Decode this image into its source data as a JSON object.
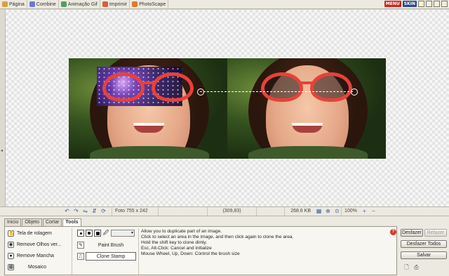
{
  "top_tabs": [
    {
      "label": "Página",
      "color": "#d8a040"
    },
    {
      "label": "Combine",
      "color": "#6a7ad0"
    },
    {
      "label": "Animação Gif",
      "color": "#50a060"
    },
    {
      "label": "Imprimir",
      "color": "#d06040"
    },
    {
      "label": "PhotoScape",
      "color": "#e07830"
    }
  ],
  "top_right": {
    "menu_label": "MENU",
    "skin_label": "SKIN"
  },
  "status": {
    "photo_info": "Foto 755 x 242",
    "coords": "(309,83)",
    "filesize": "268.6 KB",
    "zoom": "100%"
  },
  "tabs": [
    "Inicio",
    "Objeto",
    "Cortar",
    "Tools"
  ],
  "active_tab": "Tools",
  "tools": [
    {
      "label": "Tela de rolagem",
      "icon": "hand-icon"
    },
    {
      "label": "Remove Olhos ver...",
      "icon": "eye-icon"
    },
    {
      "label": "Remove Mancha",
      "icon": "spot-icon"
    },
    {
      "label": "Mosaico",
      "icon": "mosaic-icon"
    }
  ],
  "brushes": [
    {
      "label": "Paint Brush",
      "icon": "paint-brush-icon"
    },
    {
      "label": "Clone Stamp",
      "icon": "clone-stamp-icon"
    }
  ],
  "help_lines": [
    "Allow you to duplicate part of an image.",
    "Click to select an area in the image, and then click again to clone the area.",
    "Hold the shift key to clone dimly.",
    "Esc, Alt-Click: Cancel and initialize",
    "Mouse Wheel, Up, Down: Control the brush size"
  ],
  "actions": {
    "undo": "Desfazer",
    "redo": "Refazer",
    "undo_all": "Desfazer Todos",
    "save": "Salvar"
  }
}
